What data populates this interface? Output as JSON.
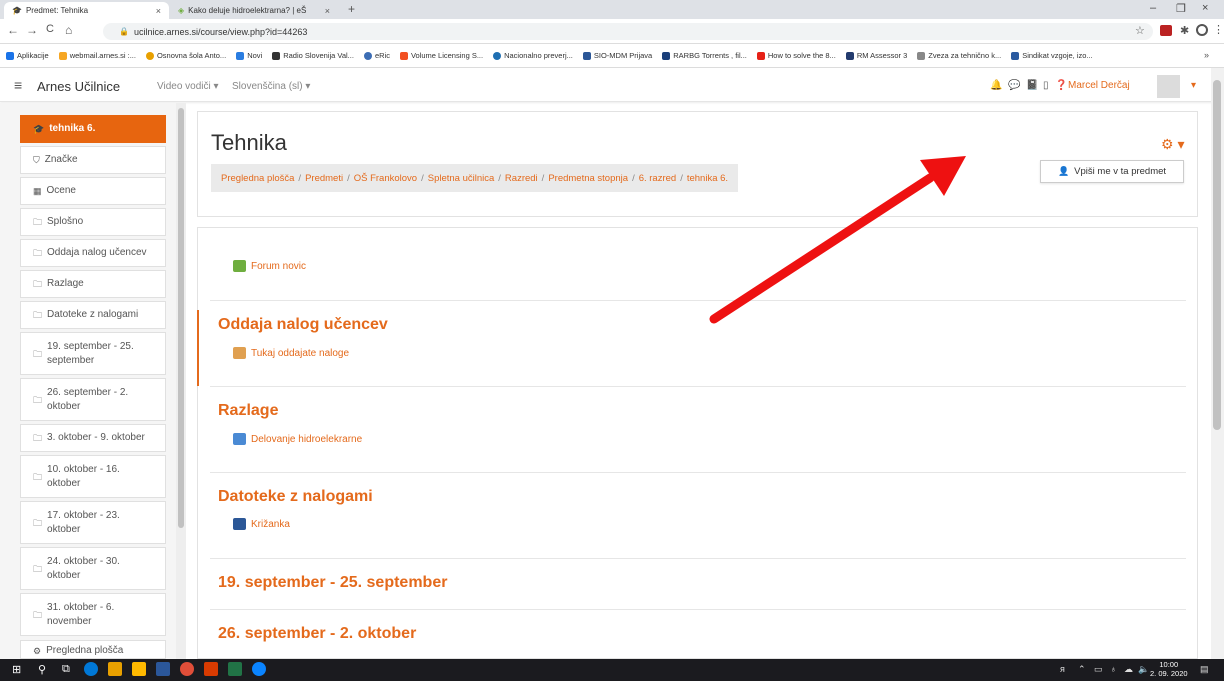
{
  "browser": {
    "tabs": [
      {
        "title": "Predmet: Tehnika",
        "close": "×"
      },
      {
        "title": "Kako deluje hidroelektrarna? | eŠ",
        "close": "×"
      }
    ],
    "new_tab": "+",
    "window_controls": [
      "–",
      "❐",
      "×"
    ],
    "nav": {
      "back": "←",
      "forward": "→",
      "reload": "C",
      "home": "⌂"
    },
    "url": "ucilnice.arnes.si/course/view.php?id=44263",
    "toolbar_icons": [
      "☆",
      "⋮"
    ],
    "bookmarks": [
      {
        "label": "Aplikacije",
        "color": "#1a73e8"
      },
      {
        "label": "webmail.arnes.si :...",
        "color": "#f6a623"
      },
      {
        "label": "Osnovna šola Anto...",
        "color": "#e8a000"
      },
      {
        "label": "Novi",
        "color": "#2a7de1"
      },
      {
        "label": "Radio Slovenija Val...",
        "color": "#333333"
      },
      {
        "label": "eRic",
        "color": "#3c6db4"
      },
      {
        "label": "Volume Licensing S...",
        "color": "#f25022"
      },
      {
        "label": "Nacionalno preverj...",
        "color": "#1f6fb2"
      },
      {
        "label": "SIO-MDM Prijava",
        "color": "#2b5797"
      },
      {
        "label": "RARBG Torrents , fil...",
        "color": "#1a3f7a"
      },
      {
        "label": "How to solve the 8...",
        "color": "#e62117"
      },
      {
        "label": "RM Assessor 3",
        "color": "#233b6e"
      },
      {
        "label": "Zveza za tehnično k...",
        "color": "#888888"
      },
      {
        "label": "Sindikat vzgoje, izo...",
        "color": "#2a5aa0"
      }
    ],
    "more_bookmarks": "»"
  },
  "navbar": {
    "menu": "≡",
    "site_name": "Arnes Učilnice",
    "links": [
      "Video vodiči ▾",
      "Slovenščina (sl) ▾"
    ],
    "user_name": "Marcel Derčaj",
    "user_caret": "▾"
  },
  "sidebar": {
    "items": [
      {
        "label": "tehnika 6.",
        "icon": "🎓",
        "active": true
      },
      {
        "label": "Značke",
        "icon": "⛉"
      },
      {
        "label": "Ocene",
        "icon": "▦"
      },
      {
        "label": "Splošno",
        "icon": "🗀"
      },
      {
        "label": "Oddaja nalog učencev",
        "icon": "🗀"
      },
      {
        "label": "Razlage",
        "icon": "🗀"
      },
      {
        "label": "Datoteke z nalogami",
        "icon": "🗀"
      },
      {
        "label": "19. september - 25. september",
        "icon": "🗀"
      },
      {
        "label": "26. september - 2. oktober",
        "icon": "🗀"
      },
      {
        "label": "3. oktober - 9. oktober",
        "icon": "🗀"
      },
      {
        "label": "10. oktober - 16. oktober",
        "icon": "🗀"
      },
      {
        "label": "17. oktober - 23. oktober",
        "icon": "🗀"
      },
      {
        "label": "24. oktober - 30. oktober",
        "icon": "🗀"
      },
      {
        "label": "31. oktober - 6. november",
        "icon": "🗀"
      },
      {
        "label": "Pregledna plošča",
        "icon": "⚙"
      }
    ]
  },
  "course": {
    "title": "Tehnika",
    "breadcrumb": [
      "Pregledna plošča",
      "Predmeti",
      "OŠ Frankolovo",
      "Spletna učilnica",
      "Razredi",
      "Predmetna stopnja",
      "6. razred",
      "tehnika 6."
    ],
    "gear": "⚙ ▾",
    "enrol_button": "Vpiši me v ta predmet"
  },
  "sections": [
    {
      "title": "",
      "activity": "Forum novic",
      "icon_color": "#6fae3f"
    },
    {
      "title": "Oddaja nalog učencev",
      "activity": "Tukaj oddajate naloge",
      "icon_color": "#e0a050"
    },
    {
      "title": "Razlage",
      "activity": "Delovanje hidroelekrarne",
      "icon_color": "#4a8ad4"
    },
    {
      "title": "Datoteke z nalogami",
      "activity": "Križanka",
      "icon_color": "#2b5797"
    },
    {
      "title": "19. september - 25. september"
    },
    {
      "title": "26. september - 2. oktober"
    }
  ],
  "taskbar": {
    "clock_time": "10:00",
    "clock_date": "2. 09. 2020",
    "app_colors": [
      "#0078d7",
      "#e8a000",
      "#ffb900",
      "#2b579a",
      "#e04e39",
      "#d83b01",
      "#217346",
      "#0a84ff"
    ]
  },
  "colors": {
    "accent": "#e46a1c",
    "active_sidebar": "#e7650f",
    "annotation_arrow": "#ee1111"
  }
}
